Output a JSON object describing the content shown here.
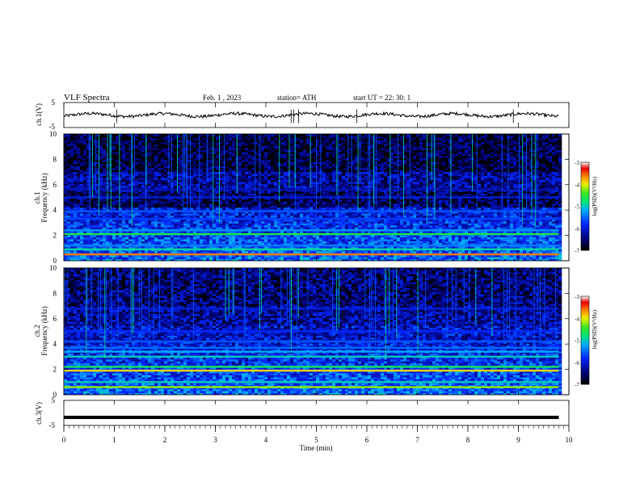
{
  "header": {
    "title": "VLF  Spectra",
    "date": "Feb. 1  , 2023",
    "station": "station= ATH",
    "start": "start  UT  =    22: 30: 1"
  },
  "chart_data": {
    "type": "heatmap",
    "title": "VLF  Spectra",
    "xlabel": "Time  (min)",
    "xlim": [
      0,
      10
    ],
    "x_ticks": [
      "0",
      "1",
      "2",
      "3",
      "4",
      "5",
      "6",
      "7",
      "8",
      "9",
      "10"
    ],
    "data_end_min": 9.8,
    "panels": [
      {
        "id": "ch1",
        "type": "line",
        "ylabel": "ch.1(V)",
        "ylim": [
          -5,
          5
        ],
        "y_ticks": [
          "5",
          "-5"
        ],
        "mean": 0,
        "spikes_min": [
          1.05,
          4.5,
          4.55,
          4.65,
          5.8,
          8.9
        ]
      },
      {
        "id": "ch2",
        "type": "spectrogram",
        "ylabel": [
          "ch.1",
          "Frequency  (kHz)"
        ],
        "ylim": [
          0,
          10
        ],
        "y_ticks": [
          "0",
          "2",
          "4",
          "6",
          "8",
          "10"
        ],
        "colorbar": {
          "label": "log(PSD)(V²/Hz)",
          "ticks": [
            "-3",
            "-4",
            "-5",
            "-6",
            "-7"
          ],
          "range": [
            -7,
            -3
          ]
        },
        "bands": [
          {
            "f": 0.5,
            "level": -3.6
          },
          {
            "f": 0.9,
            "level": -4.9
          },
          {
            "f": 1.2,
            "level": -5.4
          },
          {
            "f": 2.1,
            "level": -4.6
          },
          {
            "f": 2.4,
            "level": -5.3
          },
          {
            "f": 3.3,
            "level": -5.7
          },
          {
            "f": 3.9,
            "level": -5.6
          },
          {
            "f": 5.0,
            "level": -6.0
          },
          {
            "f": 5.6,
            "level": -6.2
          }
        ]
      },
      {
        "id": "ch3",
        "type": "spectrogram",
        "ylabel": [
          "ch.2",
          "Frequency  (kHz)"
        ],
        "ylim": [
          0,
          10
        ],
        "y_ticks": [
          "0",
          "2",
          "4",
          "6",
          "8",
          "10"
        ],
        "colorbar": {
          "label": "log(PSD)(V²/Hz)",
          "ticks": [
            "-3",
            "-4",
            "-5",
            "-6",
            "-7"
          ],
          "range": [
            -7,
            -3
          ]
        },
        "bands": [
          {
            "f": 0.6,
            "level": -4.2
          },
          {
            "f": 1.0,
            "level": -5.0
          },
          {
            "f": 1.9,
            "level": -3.9
          },
          {
            "f": 2.2,
            "level": -4.7
          },
          {
            "f": 3.0,
            "level": -5.0
          },
          {
            "f": 3.4,
            "level": -5.2
          },
          {
            "f": 3.7,
            "level": -5.5
          },
          {
            "f": 4.2,
            "level": -5.6
          },
          {
            "f": 5.0,
            "level": -5.8
          },
          {
            "f": 6.8,
            "level": -6.0
          }
        ]
      },
      {
        "id": "ch3v",
        "type": "line",
        "ylabel": "ch.3(V)",
        "ylim": [
          -5,
          5
        ],
        "y_ticks": [
          "5",
          "-5"
        ],
        "mean": -1.8
      }
    ]
  }
}
